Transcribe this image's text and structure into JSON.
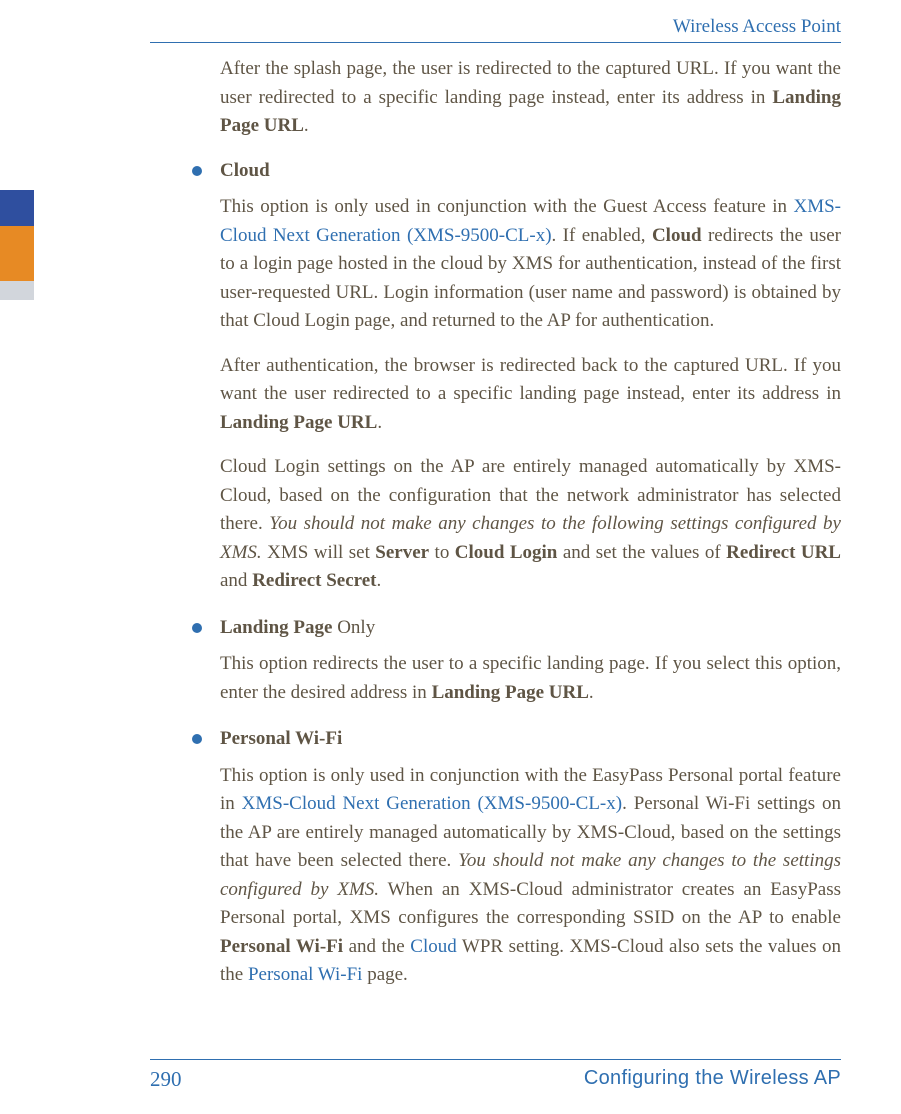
{
  "header": {
    "title": "Wireless Access Point"
  },
  "intro_para": {
    "pre": "After the splash page, the user is redirected to the captured URL. If you want the user redirected to a specific landing page instead, enter its address in ",
    "bold": "Landing Page URL",
    "post": "."
  },
  "items": [
    {
      "heading": "Cloud",
      "paras": [
        {
          "runs": [
            {
              "t": "This option is only used in conjunction with the Guest Access feature in "
            },
            {
              "t": "XMS-Cloud Next Generation (XMS-9500-CL-x)",
              "cls": "link"
            },
            {
              "t": ". If enabled, "
            },
            {
              "t": "Cloud",
              "cls": "bold"
            },
            {
              "t": " redirects the user to a login page hosted in the cloud by XMS for authentication, instead of the first user-requested URL. Login information (user name and password) is obtained by that Cloud Login page, and returned to the AP for authentication."
            }
          ]
        },
        {
          "runs": [
            {
              "t": "After authentication, the browser is redirected back to the captured URL. If you want the user redirected to a specific landing page instead, enter its address in "
            },
            {
              "t": "Landing Page URL",
              "cls": "bold"
            },
            {
              "t": "."
            }
          ]
        },
        {
          "runs": [
            {
              "t": "Cloud Login settings on the AP are entirely managed automatically by XMS-Cloud, based on the configuration that the network administrator has selected there. "
            },
            {
              "t": "You should not make any changes to the following settings configured by XMS.",
              "cls": "italic"
            },
            {
              "t": " XMS will set "
            },
            {
              "t": "Server",
              "cls": "bold"
            },
            {
              "t": " to "
            },
            {
              "t": "Cloud Login",
              "cls": "bold"
            },
            {
              "t": " and set the values of "
            },
            {
              "t": "Redirect URL",
              "cls": "bold"
            },
            {
              "t": " and "
            },
            {
              "t": "Redirect Secret",
              "cls": "bold"
            },
            {
              "t": "."
            }
          ]
        }
      ]
    },
    {
      "heading_runs": [
        {
          "t": "Landing Page",
          "cls": "bold"
        },
        {
          "t": " Only"
        }
      ],
      "paras": [
        {
          "runs": [
            {
              "t": "This option redirects the user to a specific landing page. If you select this option, enter the desired address in "
            },
            {
              "t": "Landing Page URL",
              "cls": "bold"
            },
            {
              "t": "."
            }
          ]
        }
      ]
    },
    {
      "heading": "Personal Wi-Fi",
      "paras": [
        {
          "runs": [
            {
              "t": "This option is only used in conjunction with the EasyPass Personal portal feature in "
            },
            {
              "t": "XMS-Cloud Next Generation (XMS-9500-CL-x)",
              "cls": "link"
            },
            {
              "t": ". Personal Wi-Fi settings on the AP are entirely managed automatically by XMS-Cloud, based on the settings that have been selected there. "
            },
            {
              "t": "You should not make any changes to the settings configured by XMS.",
              "cls": "italic"
            },
            {
              "t": " When an XMS-Cloud administrator creates an EasyPass Personal portal, XMS configures the corresponding SSID on the AP to enable "
            },
            {
              "t": "Personal Wi-Fi",
              "cls": "bold"
            },
            {
              "t": " and the "
            },
            {
              "t": "Cloud",
              "cls": "link"
            },
            {
              "t": " WPR setting. XMS-Cloud also sets the values on the "
            },
            {
              "t": "Personal Wi-Fi",
              "cls": "link"
            },
            {
              "t": " page."
            }
          ]
        }
      ]
    }
  ],
  "footer": {
    "page": "290",
    "section": "Configuring the Wireless AP"
  }
}
